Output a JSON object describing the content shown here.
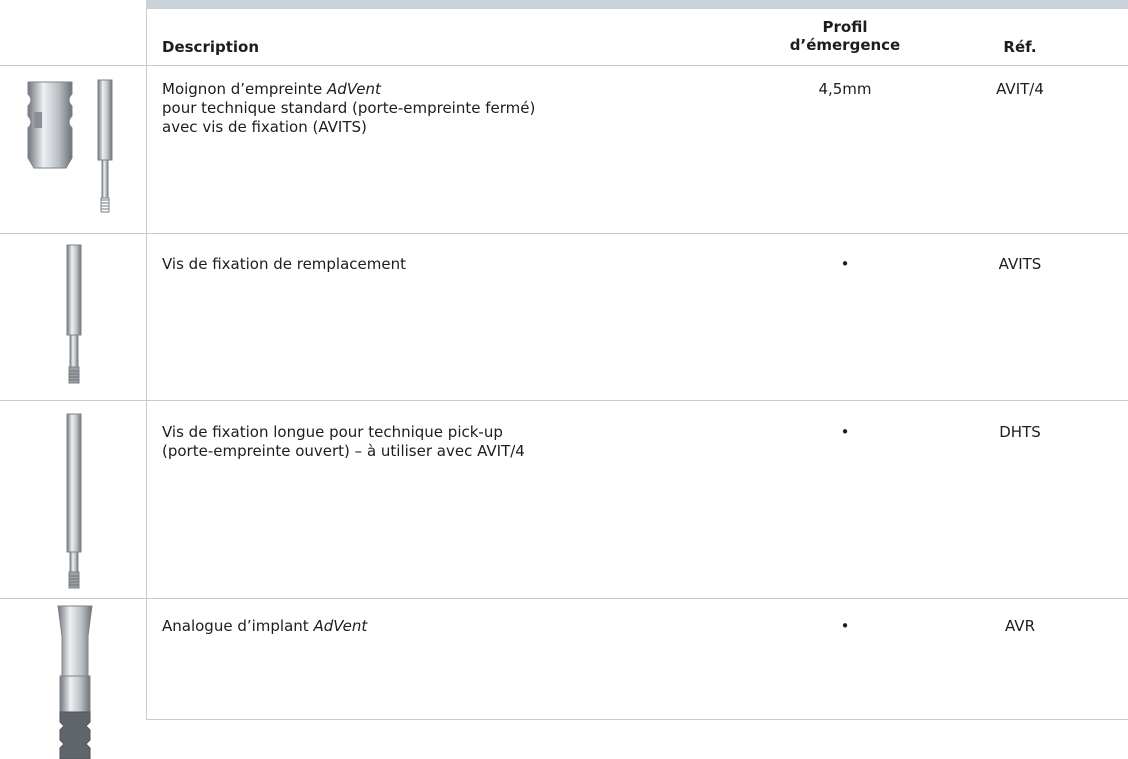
{
  "table": {
    "headers": {
      "description": "Description",
      "profil_line1": "Profil",
      "profil_line2": "d’émergence",
      "ref": "Réf."
    },
    "rows": [
      {
        "desc_line1_prefix": "Moignon d’empreinte ",
        "desc_line1_italic": "AdVent",
        "desc_line2": "pour technique standard (porte-empreinte fermé)",
        "desc_line3": "avec vis de fixation (AVITS)",
        "profil": "4,5mm",
        "ref": "AVIT/4",
        "image_icon": "impression-coping-with-screw-icon"
      },
      {
        "desc_line1": "Vis de fixation de remplacement",
        "profil": "•",
        "ref": "AVITS",
        "image_icon": "fixation-screw-icon"
      },
      {
        "desc_line1": "Vis de fixation longue pour technique pick-up",
        "desc_line2": "(porte-empreinte ouvert) – à utiliser avec AVIT/4",
        "profil": "•",
        "ref": "DHTS",
        "image_icon": "long-fixation-screw-icon"
      },
      {
        "desc_line1_prefix": "Analogue d’implant ",
        "desc_line1_italic": "AdVent",
        "profil": "•",
        "ref": "AVR",
        "image_icon": "implant-analog-icon"
      }
    ]
  },
  "colors": {
    "rule": "#c3ccd3",
    "header_band": "#c9d2d9",
    "metal_light": "#e6e9ec",
    "metal_mid": "#b7bcc1",
    "metal_dark": "#6f757b"
  }
}
